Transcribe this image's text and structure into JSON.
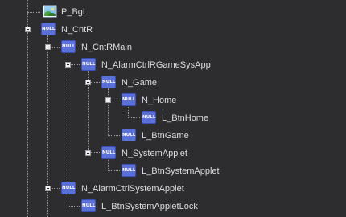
{
  "tree": {
    "items": [
      {
        "label": "P_BgL",
        "icon": "image-icon"
      },
      {
        "label": "N_CntR",
        "icon": "null-icon",
        "icon_text": "NULL"
      },
      {
        "label": "N_CntRMain",
        "icon": "null-icon",
        "icon_text": "NULL"
      },
      {
        "label": "N_AlarmCtrlRGameSysApp",
        "icon": "null-icon",
        "icon_text": "NULL"
      },
      {
        "label": "N_Game",
        "icon": "null-icon",
        "icon_text": "NULL"
      },
      {
        "label": "N_Home",
        "icon": "null-icon",
        "icon_text": "NULL"
      },
      {
        "label": "L_BtnHome",
        "icon": "null-icon",
        "icon_text": "NULL"
      },
      {
        "label": "L_BtnGame",
        "icon": "null-icon",
        "icon_text": "NULL"
      },
      {
        "label": "N_SystemApplet",
        "icon": "null-icon",
        "icon_text": "NULL"
      },
      {
        "label": "L_BtnSystemApplet",
        "icon": "null-icon",
        "icon_text": "NULL"
      },
      {
        "label": "N_AlarmCtrlSystemApplet",
        "icon": "null-icon",
        "icon_text": "NULL"
      },
      {
        "label": "L_BtnSystemAppletLock",
        "icon": "null-icon",
        "icon_text": "NULL"
      }
    ]
  },
  "colors": {
    "background": "#2d2d30",
    "text": "#dcdcdc",
    "null_icon": "#5b6fd8"
  }
}
